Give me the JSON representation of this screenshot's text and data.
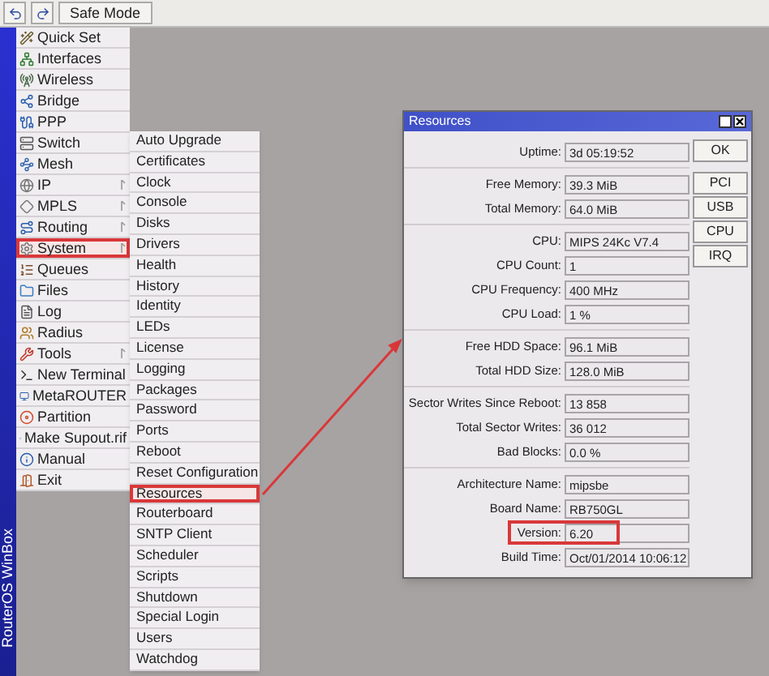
{
  "toolbar": {
    "safe_mode": "Safe Mode"
  },
  "brand": "RouterOS WinBox",
  "menu": [
    {
      "label": "Quick Set",
      "has_submenu": false,
      "selected": false
    },
    {
      "label": "Interfaces",
      "has_submenu": false,
      "selected": false
    },
    {
      "label": "Wireless",
      "has_submenu": false,
      "selected": false
    },
    {
      "label": "Bridge",
      "has_submenu": false,
      "selected": false
    },
    {
      "label": "PPP",
      "has_submenu": false,
      "selected": false
    },
    {
      "label": "Switch",
      "has_submenu": false,
      "selected": false
    },
    {
      "label": "Mesh",
      "has_submenu": false,
      "selected": false
    },
    {
      "label": "IP",
      "has_submenu": true,
      "selected": false
    },
    {
      "label": "MPLS",
      "has_submenu": true,
      "selected": false
    },
    {
      "label": "Routing",
      "has_submenu": true,
      "selected": false
    },
    {
      "label": "System",
      "has_submenu": true,
      "selected": true
    },
    {
      "label": "Queues",
      "has_submenu": false,
      "selected": false
    },
    {
      "label": "Files",
      "has_submenu": false,
      "selected": false
    },
    {
      "label": "Log",
      "has_submenu": false,
      "selected": false
    },
    {
      "label": "Radius",
      "has_submenu": false,
      "selected": false
    },
    {
      "label": "Tools",
      "has_submenu": true,
      "selected": false
    },
    {
      "label": "New Terminal",
      "has_submenu": false,
      "selected": false
    },
    {
      "label": "MetaROUTER",
      "has_submenu": false,
      "selected": false
    },
    {
      "label": "Partition",
      "has_submenu": false,
      "selected": false
    },
    {
      "label": "Make Supout.rif",
      "has_submenu": false,
      "selected": false
    },
    {
      "label": "Manual",
      "has_submenu": false,
      "selected": false
    },
    {
      "label": "Exit",
      "has_submenu": false,
      "selected": false
    }
  ],
  "submenu": [
    {
      "label": "Auto Upgrade",
      "selected": false
    },
    {
      "label": "Certificates",
      "selected": false
    },
    {
      "label": "Clock",
      "selected": false
    },
    {
      "label": "Console",
      "selected": false
    },
    {
      "label": "Disks",
      "selected": false
    },
    {
      "label": "Drivers",
      "selected": false
    },
    {
      "label": "Health",
      "selected": false
    },
    {
      "label": "History",
      "selected": false
    },
    {
      "label": "Identity",
      "selected": false
    },
    {
      "label": "LEDs",
      "selected": false
    },
    {
      "label": "License",
      "selected": false
    },
    {
      "label": "Logging",
      "selected": false
    },
    {
      "label": "Packages",
      "selected": false
    },
    {
      "label": "Password",
      "selected": false
    },
    {
      "label": "Ports",
      "selected": false
    },
    {
      "label": "Reboot",
      "selected": false
    },
    {
      "label": "Reset Configuration",
      "selected": false
    },
    {
      "label": "Resources",
      "selected": true
    },
    {
      "label": "Routerboard",
      "selected": false
    },
    {
      "label": "SNTP Client",
      "selected": false
    },
    {
      "label": "Scheduler",
      "selected": false
    },
    {
      "label": "Scripts",
      "selected": false
    },
    {
      "label": "Shutdown",
      "selected": false
    },
    {
      "label": "Special Login",
      "selected": false
    },
    {
      "label": "Users",
      "selected": false
    },
    {
      "label": "Watchdog",
      "selected": false
    }
  ],
  "window": {
    "title": "Resources",
    "groups": [
      [
        {
          "label": "Uptime:",
          "value": "3d 05:19:52",
          "highlighted": false
        }
      ],
      [
        {
          "label": "Free Memory:",
          "value": "39.3 MiB",
          "highlighted": false
        },
        {
          "label": "Total Memory:",
          "value": "64.0 MiB",
          "highlighted": false
        }
      ],
      [
        {
          "label": "CPU:",
          "value": "MIPS 24Kc V7.4",
          "highlighted": false
        },
        {
          "label": "CPU Count:",
          "value": "1",
          "highlighted": false
        },
        {
          "label": "CPU Frequency:",
          "value": "400 MHz",
          "highlighted": false
        },
        {
          "label": "CPU Load:",
          "value": "1 %",
          "highlighted": false
        }
      ],
      [
        {
          "label": "Free HDD Space:",
          "value": "96.1 MiB",
          "highlighted": false
        },
        {
          "label": "Total HDD Size:",
          "value": "128.0 MiB",
          "highlighted": false
        }
      ],
      [
        {
          "label": "Sector Writes Since Reboot:",
          "value": "13 858",
          "highlighted": false
        },
        {
          "label": "Total Sector Writes:",
          "value": "36 012",
          "highlighted": false
        },
        {
          "label": "Bad Blocks:",
          "value": "0.0 %",
          "highlighted": false
        }
      ],
      [
        {
          "label": "Architecture Name:",
          "value": "mipsbe",
          "highlighted": false
        },
        {
          "label": "Board Name:",
          "value": "RB750GL",
          "highlighted": false
        },
        {
          "label": "Version:",
          "value": "6.20",
          "highlighted": true
        },
        {
          "label": "Build Time:",
          "value": "Oct/01/2014 10:06:12",
          "highlighted": false
        }
      ]
    ],
    "buttons": [
      "OK",
      "PCI",
      "USB",
      "CPU",
      "IRQ"
    ]
  }
}
